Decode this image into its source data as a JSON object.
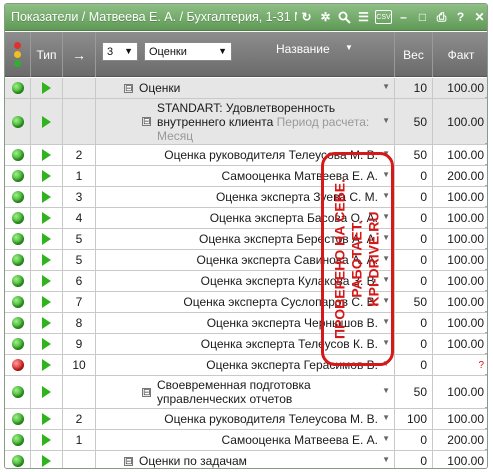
{
  "window": {
    "title": "Показатели / Матвеева Е. А. / Бухгалтерия, 1-31 Ма",
    "toolbar_icons": [
      "refresh-icon",
      "settings-icon",
      "search-icon",
      "list-icon",
      "export-icon",
      "minimize-icon",
      "restore-icon",
      "print-icon",
      "help-icon",
      "close-icon"
    ],
    "export_label": "CSV"
  },
  "header": {
    "type": "Тип",
    "arrow": "→",
    "level_value": "3",
    "filter_value": "Оценки",
    "name": "Название",
    "weight": "Вес",
    "fact": "Факт"
  },
  "rows": [
    {
      "status": "green",
      "num": "",
      "name": "Оценки",
      "toggle": "⊟",
      "weight": "10",
      "fact": "100.00",
      "group": true
    },
    {
      "status": "green",
      "num": "",
      "name": "STANDART: Удовлетворенность внутреннего клиента",
      "sub": "Период расчета: Месяц",
      "toggle": "⊟",
      "weight": "50",
      "fact": "100.00",
      "group": true
    },
    {
      "status": "green",
      "num": "2",
      "name": "Оценка руководителя Телеусова М. В.",
      "weight": "50",
      "fact": "100.00"
    },
    {
      "status": "green",
      "num": "1",
      "name": "Самооценка Матвеева Е. А.",
      "weight": "0",
      "fact": "200.00"
    },
    {
      "status": "green",
      "num": "3",
      "name": "Оценка эксперта Зуева С. М.",
      "weight": "0",
      "fact": "100.00"
    },
    {
      "status": "green",
      "num": "4",
      "name": "Оценка эксперта Басова О. А.",
      "weight": "0",
      "fact": "100.00"
    },
    {
      "status": "green",
      "num": "5",
      "name": "Оценка эксперта Берестов А. А.",
      "weight": "0",
      "fact": "100.00"
    },
    {
      "status": "green",
      "num": "5",
      "name": "Оценка эксперта Савинова А. А.",
      "weight": "0",
      "fact": "100.00"
    },
    {
      "status": "green",
      "num": "6",
      "name": "Оценка эксперта Кулакова З. В.",
      "weight": "0",
      "fact": "100.00"
    },
    {
      "status": "green",
      "num": "7",
      "name": "Оценка эксперта Суслопаров С. В.",
      "weight": "50",
      "fact": "100.00"
    },
    {
      "status": "green",
      "num": "8",
      "name": "Оценка эксперта Чернышов В.",
      "weight": "0",
      "fact": "100.00"
    },
    {
      "status": "green",
      "num": "9",
      "name": "Оценка эксперта Телеусов К. В.",
      "weight": "0",
      "fact": "100.00"
    },
    {
      "status": "red",
      "num": "10",
      "name": "Оценка эксперта Герасимов В.",
      "weight": "0",
      "fact": "?"
    },
    {
      "status": "green",
      "num": "",
      "name": "Своевременная подготовка управленческих отчетов",
      "toggle": "⊟",
      "weight": "50",
      "fact": "100.00",
      "group": false
    },
    {
      "status": "green",
      "num": "2",
      "name": "Оценка руководителя Телеусова М. В.",
      "weight": "100",
      "fact": "100.00"
    },
    {
      "status": "green",
      "num": "1",
      "name": "Самооценка Матвеева Е. А.",
      "weight": "0",
      "fact": "200.00"
    },
    {
      "status": "green",
      "num": "",
      "name": "Оценки по задачам",
      "toggle": "⊟",
      "weight": "0",
      "fact": "100.00",
      "group": false
    },
    {
      "status": "green",
      "num": "0",
      "name": "Оценка руководителя Телеусова М. В.",
      "weight": "100",
      "fact": "100.00"
    }
  ],
  "stamp": {
    "line1": "ПРОВЕРЕНО НА СЕБЕ.",
    "line2": "РАБОТАЕТ.",
    "line3": "KPI-DRIVE.RU"
  },
  "colors": {
    "green": "#2fa31f",
    "red": "#d11a1a",
    "title_bar": "#6fa866",
    "header": "#7a7a7a",
    "stamp": "#d61818"
  }
}
